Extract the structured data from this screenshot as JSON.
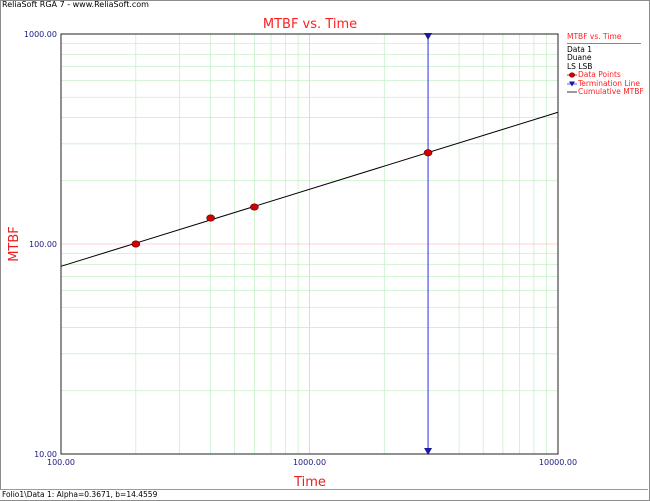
{
  "app_title": "ReliaSoft RGA 7 - www.ReliaSoft.com",
  "status_text": "Folio1\\Data 1: Alpha=0.3671, b=14.4559",
  "colors": {
    "title": "#ff2020",
    "axis_label": "#e82020",
    "tick_label": "#1a1a80",
    "major_grid": "#ffc0c0",
    "minor_grid": "#c8f0c8",
    "fit_line": "#000000",
    "data_point_fill": "#d40000",
    "termination_line": "#3030e0",
    "termination_marker": "#1a1aa0"
  },
  "legend": {
    "title": "MTBF vs. Time",
    "lines": [
      "Data 1",
      "Duane",
      "LS LSB"
    ],
    "items": [
      {
        "label": "Data Points",
        "icon": "red-dot-icon"
      },
      {
        "label": "Termination Line",
        "icon": "blue-triangle-icon"
      },
      {
        "label": "Cumulative MTBF",
        "icon": "line-icon"
      }
    ]
  },
  "chart_data": {
    "type": "line",
    "title": "MTBF vs. Time",
    "xlabel": "Time",
    "ylabel": "MTBF",
    "x_scale": "log",
    "y_scale": "log",
    "xlim": [
      100,
      10000
    ],
    "ylim": [
      10,
      1000
    ],
    "x_tick_labels": [
      "100.00",
      "1000.00",
      "10000.00"
    ],
    "y_tick_labels": [
      "10.00",
      "100.00",
      "1000.00"
    ],
    "grid": true,
    "legend_position": "right",
    "series": [
      {
        "name": "Data Points",
        "kind": "scatter",
        "x": [
          200,
          400,
          600,
          3000
        ],
        "y": [
          100,
          133,
          150,
          272
        ]
      },
      {
        "name": "Cumulative MTBF",
        "kind": "line",
        "x": [
          100,
          10000
        ],
        "y": [
          78.3,
          424
        ]
      },
      {
        "name": "Termination Line",
        "kind": "vertical-line",
        "x": 3000
      }
    ]
  }
}
